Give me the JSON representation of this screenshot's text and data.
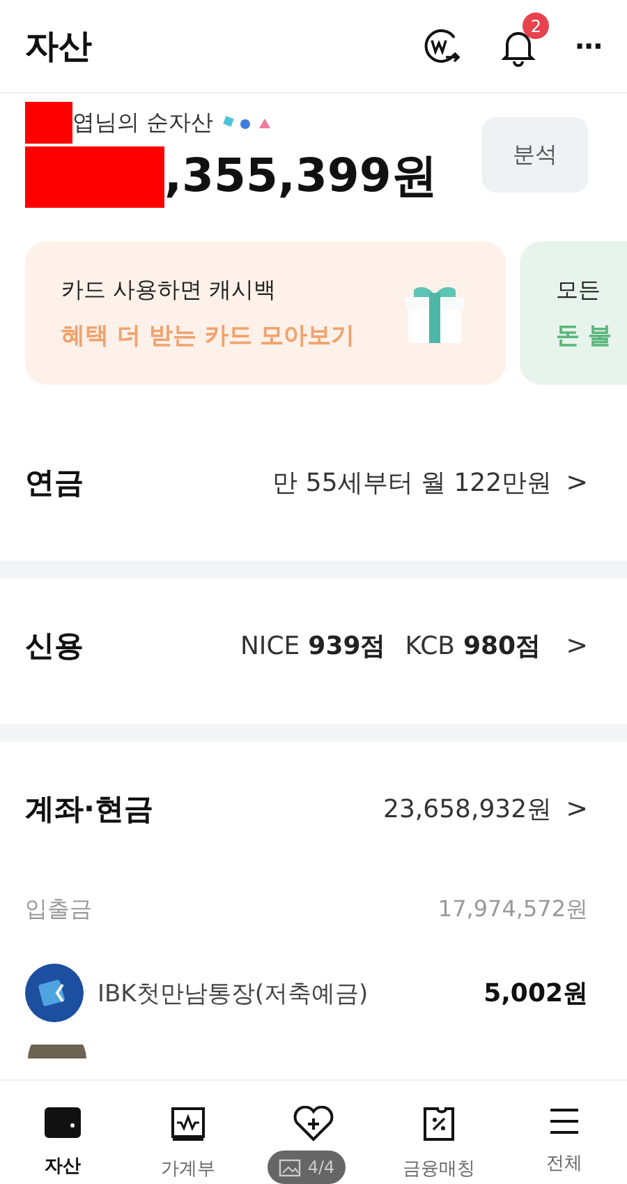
{
  "header": {
    "title": "자산",
    "notification_count": "2",
    "more": "···"
  },
  "net_worth": {
    "label": "엽님의 순자산",
    "amount": ",355,399원",
    "button": "분석",
    "redacted": true
  },
  "promo_cards": [
    {
      "line1": "카드 사용하면 캐시백",
      "line2": "혜택 더 받는 카드 모아보기",
      "color": "#f0a36e",
      "kind": "gift"
    },
    {
      "line1": "모든",
      "line2": "돈 불",
      "color": "#5bb57e",
      "kind": "none"
    }
  ],
  "sections": [
    {
      "title": "연금",
      "parts": [
        {
          "text": "만 55세부터 월 122만원",
          "bold": false
        }
      ],
      "chevron": ">"
    },
    {
      "title": "신용",
      "parts": [
        {
          "text": "NICE ",
          "bold": false
        },
        {
          "text": "939점",
          "bold": true
        },
        {
          "text": "KCB ",
          "bold": false
        },
        {
          "text": "980점",
          "bold": true
        }
      ],
      "chevron": ">"
    },
    {
      "title": "계좌·현금",
      "parts": [
        {
          "text": "23,658,932원",
          "bold": false
        }
      ],
      "chevron": ">"
    }
  ],
  "subheader": {
    "label": "입출금",
    "amount": "17,974,572원"
  },
  "accounts": [
    {
      "name": "IBK첫만남통장(저축예금)",
      "amount": "5,002원"
    }
  ],
  "tabs": [
    {
      "label": "자산",
      "selected": true
    },
    {
      "label": "가계부",
      "selected": false
    },
    {
      "selected": false
    },
    {
      "label": "금융매칭",
      "selected": false
    },
    {
      "label": "전체",
      "selected": false
    }
  ],
  "image_counter": "4/4"
}
